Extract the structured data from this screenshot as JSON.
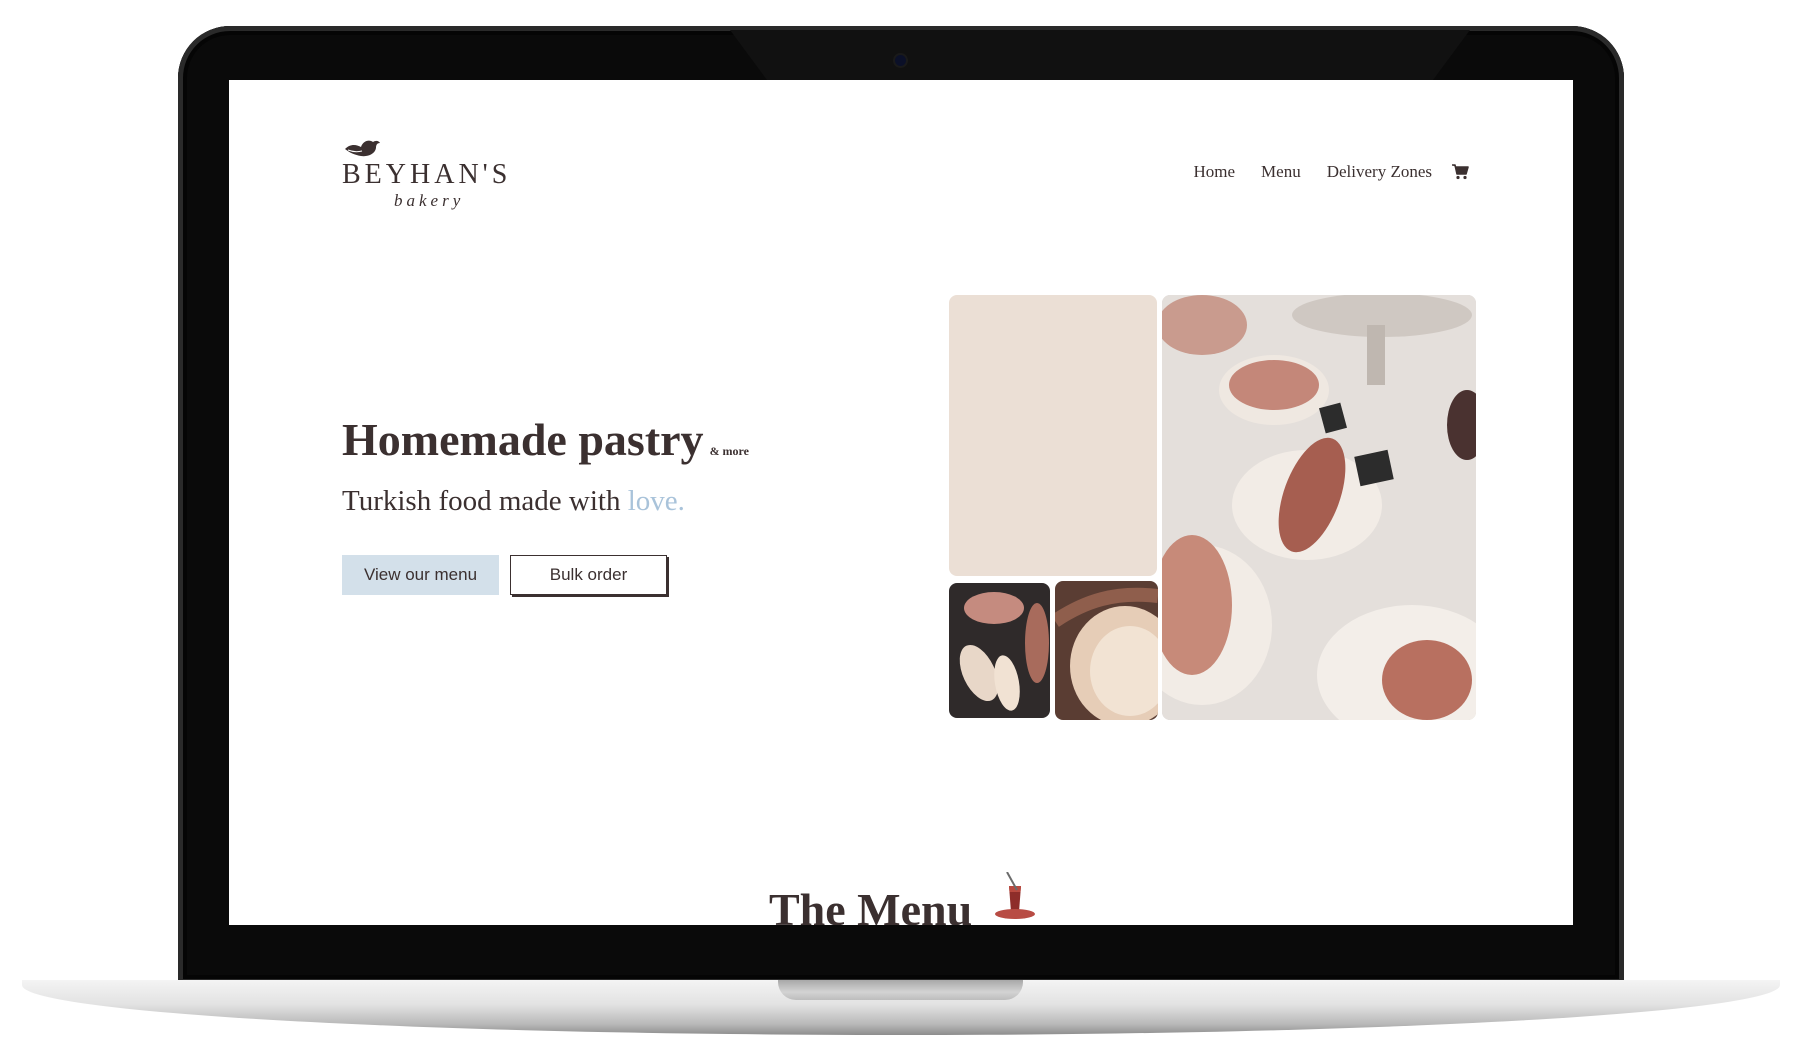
{
  "brand": {
    "name": "BEYHAN'S",
    "subtitle": "bakery"
  },
  "nav": {
    "items": [
      {
        "label": "Home"
      },
      {
        "label": "Menu"
      },
      {
        "label": "Delivery Zones"
      }
    ],
    "cart_icon": "shopping-cart-icon"
  },
  "hero": {
    "title": "Homemade pastry",
    "title_small": "& more",
    "subtitle_main": "Turkish food made with",
    "subtitle_accent": "love.",
    "primary_button": "View our menu",
    "secondary_button": "Bulk order"
  },
  "menu_section": {
    "heading": "The Menu",
    "icon": "tea-glass-icon"
  },
  "colors": {
    "text": "#3b3030",
    "accent": "#a9c3da",
    "primary_button_bg": "#d3e0ea",
    "collage_blank": "#ebdfd5"
  }
}
